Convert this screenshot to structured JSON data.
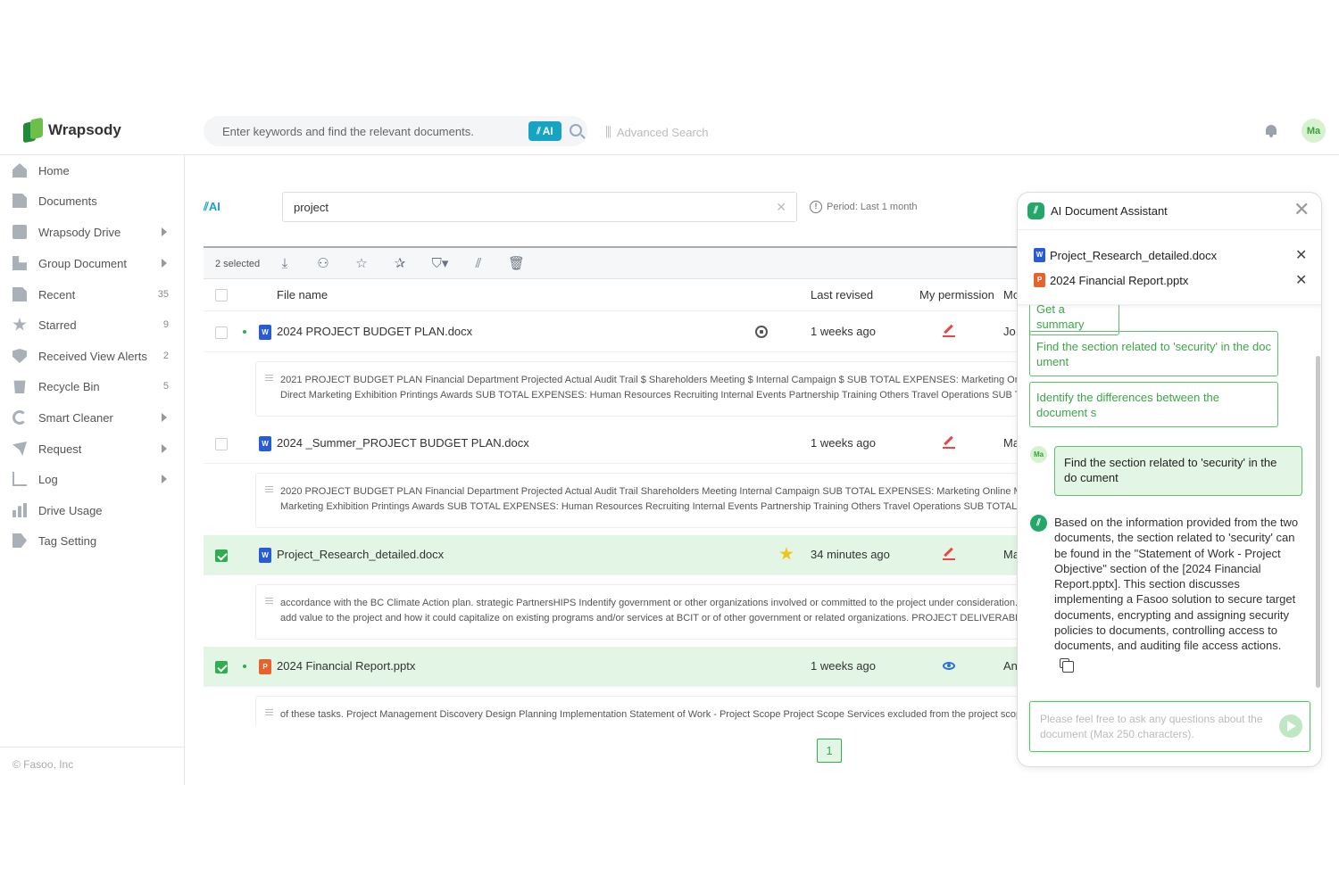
{
  "header": {
    "logo_text": "Wrapsody",
    "search_placeholder": "Enter keywords and find the relevant documents.",
    "ai_badge": "AI",
    "advanced_search": "Advanced Search",
    "avatar": "Ma"
  },
  "sidebar": {
    "items": [
      {
        "label": "Home",
        "icon": "home-icon",
        "count": "",
        "arrow": false
      },
      {
        "label": "Documents",
        "icon": "document-icon",
        "count": "",
        "arrow": false
      },
      {
        "label": "Wrapsody Drive",
        "icon": "drive-icon",
        "count": "",
        "arrow": true
      },
      {
        "label": "Group Document",
        "icon": "group-document-icon",
        "count": "",
        "arrow": true
      },
      {
        "label": "Recent",
        "icon": "recent-icon",
        "count": "35",
        "arrow": false
      },
      {
        "label": "Starred",
        "icon": "star-icon",
        "count": "9",
        "arrow": false
      },
      {
        "label": "Received View Alerts",
        "icon": "alert-icon",
        "count": "2",
        "arrow": false
      },
      {
        "label": "Recycle Bin",
        "icon": "trash-icon",
        "count": "5",
        "arrow": false
      },
      {
        "label": "Smart Cleaner",
        "icon": "cleaner-icon",
        "count": "",
        "arrow": true
      },
      {
        "label": "Request",
        "icon": "request-icon",
        "count": "",
        "arrow": true
      },
      {
        "label": "Log",
        "icon": "log-icon",
        "count": "",
        "arrow": true
      },
      {
        "label": "Drive Usage",
        "icon": "usage-icon",
        "count": "",
        "arrow": false
      },
      {
        "label": "Tag Setting",
        "icon": "tag-icon",
        "count": "",
        "arrow": false
      }
    ],
    "copyright": "© Fasoo, Inc"
  },
  "main": {
    "ai_label": "AI",
    "query": "project",
    "period": "Period: Last 1 month",
    "selected_count": "2 selected",
    "columns": {
      "file_name": "File name",
      "last_revised": "Last revised",
      "my_permission": "My permission",
      "modifier": "Mo"
    },
    "rows": [
      {
        "name": "2024 PROJECT BUDGET PLAN.docx",
        "type": "W",
        "revised": "1 weeks ago",
        "owner": "Jo",
        "selected": false,
        "snippet": [
          "2021 PROJECT BUDGET PLAN Financial Department Projected Actual Audit Trail $ Shareholders Meeting $ Internal Campaign $ SUB TOTAL EXPENSES: Marketing Online Marketing",
          "Direct Marketing Exhibition Printings Awards SUB TOTAL EXPENSES: Human Resources Recruiting Internal Events Partnership Training Others Travel Operations SUB TOTAL EXPENSES"
        ]
      },
      {
        "name": "2024 _Summer_PROJECT BUDGET PLAN.docx",
        "type": "W",
        "revised": "1 weeks ago",
        "owner": "Ma",
        "selected": false,
        "snippet": [
          "2020 PROJECT BUDGET PLAN Financial Department Projected Actual Audit Trail Shareholders Meeting Internal Campaign SUB TOTAL EXPENSES: Marketing Online Marketing Direct",
          "Marketing Exhibition Printings Awards SUB TOTAL EXPENSES: Human Resources Recruiting Internal Events Partnership Training Others Travel Operations SUB TOTAL EXPENSES"
        ]
      },
      {
        "name": "Project_Research_detailed.docx",
        "type": "W",
        "revised": "34 minutes ago",
        "owner": "Ma",
        "selected": true,
        "snippet": [
          "accordance with the BC Climate Action plan. strategic PartnersHIPS Indentify government or other organizations involved or committed to the project under consideration. Describe",
          "add value to the project and how it could capitalize on existing programs and/or services at BCIT or of other government or related organizations. PROJECT DELIVERABLES Describe"
        ]
      },
      {
        "name": "2024 Financial Report.pptx",
        "type": "P",
        "revised": "1 weeks ago",
        "owner": "An",
        "selected": true,
        "snippet": [
          "of these tasks. Project Management Discovery Design Planning Implementation Statement of Work - Project Scope Project Scope Services excluded from the project scope The"
        ]
      }
    ],
    "page": "1"
  },
  "assistant": {
    "title": "AI Document Assistant",
    "files": [
      {
        "name": "Project_Research_detailed.docx",
        "type": "W"
      },
      {
        "name": "2024 Financial Report.pptx",
        "type": "P"
      }
    ],
    "suggestions": [
      "Get a summary",
      "Find the section related to 'security' in the doc ument",
      "Identify the differences between the document s"
    ],
    "user_avatar": "Ma",
    "user_message": "Find the section related to 'security' in the do cument",
    "bot_message": "Based on the information provided from the two documents, the section related to 'security' can be found in the \"Statement of Work - Project Objective\" section of the [2024 Financial Report.pptx]. This section discusses implementing a Fasoo solution to secure target documents, encrypting and assigning security policies to documents, controlling access to documents, and auditing file access actions.",
    "input_placeholder": "Please feel free to ask any questions about the document (Max 250 characters)."
  },
  "colors": {
    "accent_green": "#2fae4f",
    "ai_blue": "#16a4c5",
    "word_blue": "#2a5bd7",
    "ppt_orange": "#e8632b"
  }
}
